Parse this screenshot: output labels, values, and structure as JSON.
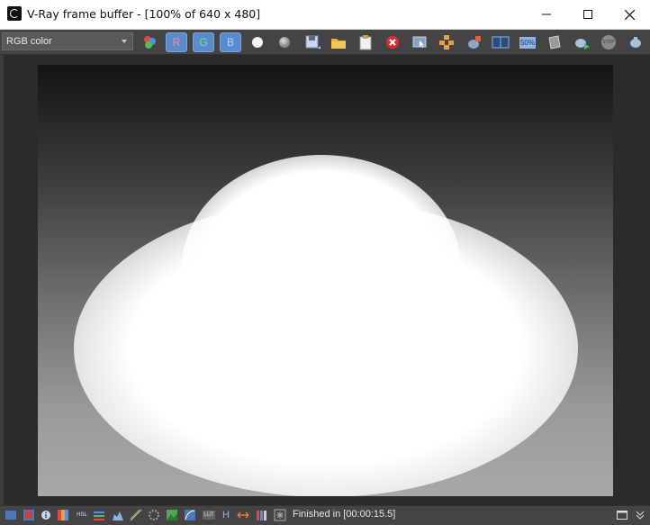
{
  "window": {
    "title": "V-Ray frame buffer - [100% of 640 x 480]",
    "controls": [
      "minimize-icon",
      "maximize-icon",
      "close-icon"
    ]
  },
  "toolbar": {
    "channel_select_value": "RGB color",
    "red_channel_label": "R",
    "green_channel_label": "G",
    "blue_channel_label": "B",
    "mono_buttons": [
      "white-circle-icon",
      "gray-circle-icon"
    ],
    "fifty_badge": "50%",
    "stop_badge": "STOP",
    "icons": [
      "color-balls-icon",
      "save-image-icon",
      "load-image-icon",
      "clipboard-icon",
      "clear-image-icon",
      "follow-mouse-icon",
      "region-render-icon",
      "teapot-last-region-icon",
      "ab-compare-icon",
      "half-resolution-icon",
      "link-to-3dsmax-icon",
      "render-teapot-icon",
      "stop-render-icon",
      "teapot-interactive-icon"
    ]
  },
  "render": {
    "description_icon": "render-preview"
  },
  "statusbar": {
    "status_text": "Finished in [00:00:15.5]",
    "h_label": "H",
    "hsl_label": "HSL",
    "lut_label": "LUT",
    "icons": [
      "display-correction-icon",
      "image-history-icon",
      "info-icon",
      "color-correction-icon",
      "hsl-icon",
      "levels-icon",
      "histogram-icon",
      "curve-icon",
      "exposure-icon",
      "background-image-icon",
      "lens-effects-icon",
      "lut-icon",
      "h-flip-icon",
      "pixel-aspect-icon",
      "bars-icon",
      "settings-icon",
      "fit-window-icon",
      "expand-icon"
    ]
  }
}
